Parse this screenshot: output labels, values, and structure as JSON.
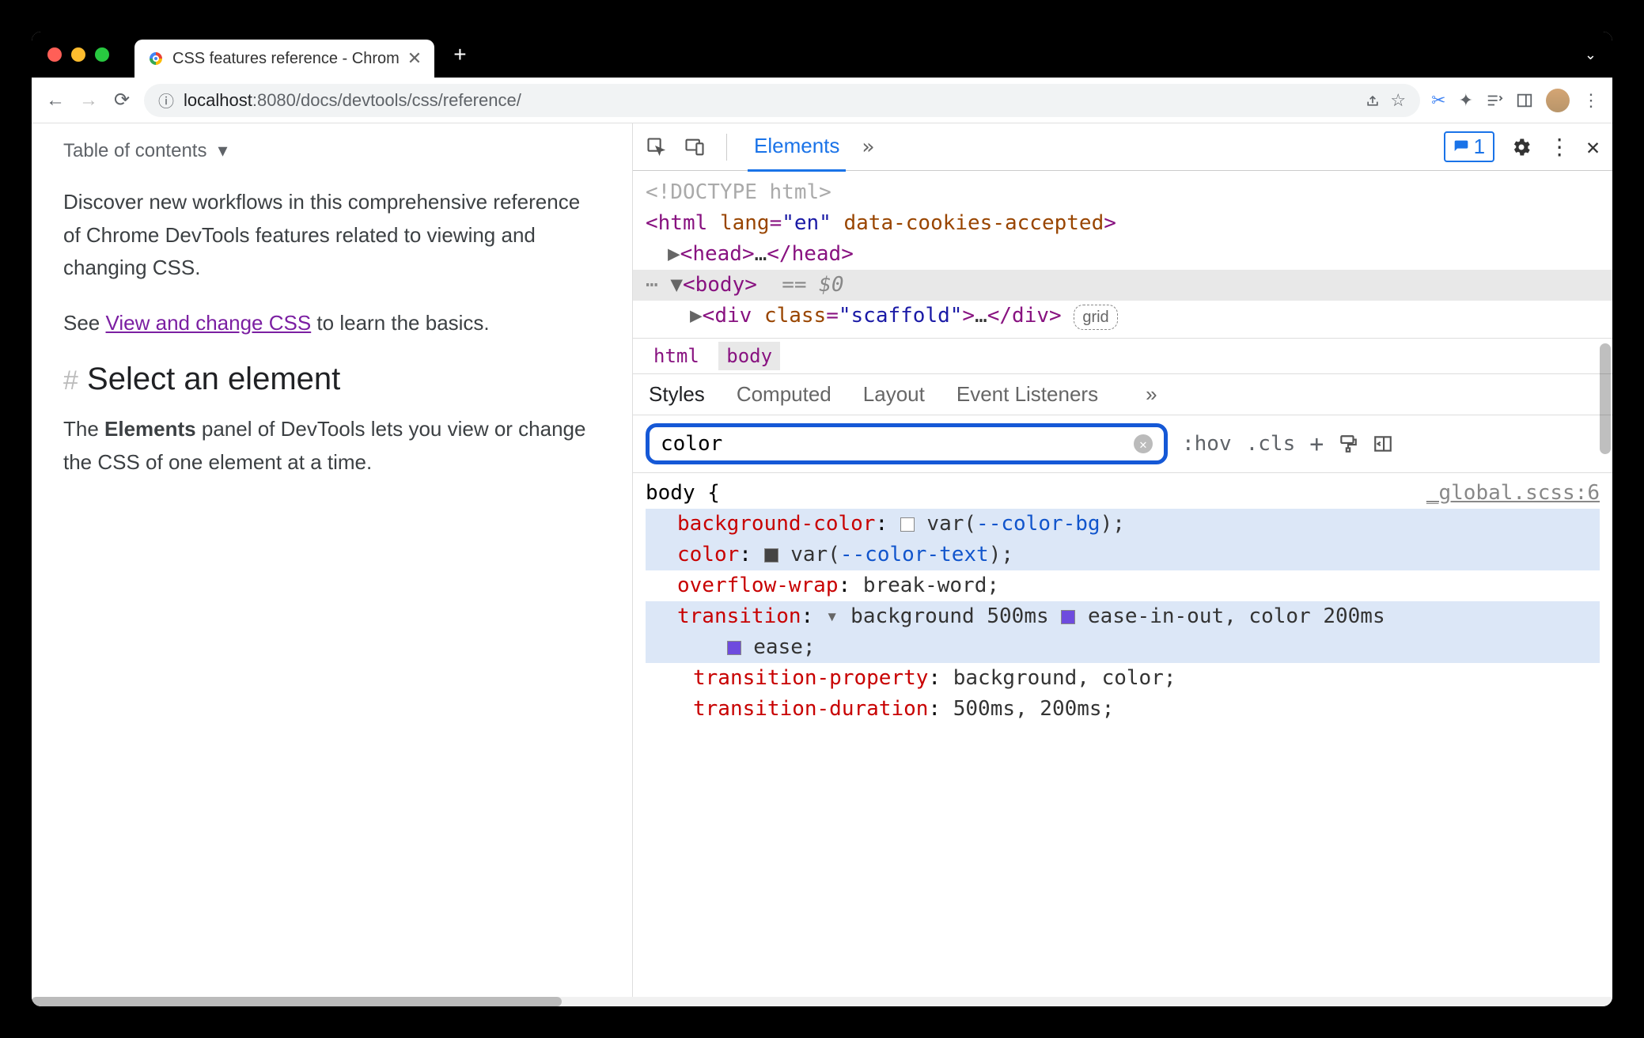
{
  "tab": {
    "title": "CSS features reference - Chrom"
  },
  "address": {
    "host": "localhost",
    "port": ":8080",
    "path": "/docs/devtools/css/reference/"
  },
  "page": {
    "toc": "Table of contents",
    "p1": "Discover new workflows in this comprehensive reference of Chrome DevTools features related to viewing and changing CSS.",
    "p2a": "See ",
    "p2link": "View and change CSS",
    "p2b": " to learn the basics.",
    "h2": "Select an element",
    "p3a": "The ",
    "p3b": "Elements",
    "p3c": " panel of DevTools lets you view or change the CSS of one element at a time."
  },
  "devtools": {
    "tabs": {
      "elements": "Elements"
    },
    "issues": "1",
    "dom": {
      "doctype": "<!DOCTYPE html>",
      "html_open": "html",
      "html_lang_attr": "lang",
      "html_lang_val": "\"en\"",
      "html_cookies_attr": "data-cookies-accepted",
      "head": "head",
      "head_ellipsis": "…",
      "body": "body",
      "body_eq": "== ",
      "body_var": "$0",
      "div": "div",
      "div_class_attr": "class",
      "div_class_val": "\"scaffold\"",
      "div_ellipsis": "…",
      "grid_badge": "grid"
    },
    "crumbs": {
      "html": "html",
      "body": "body"
    },
    "styles_tabs": {
      "styles": "Styles",
      "computed": "Computed",
      "layout": "Layout",
      "events": "Event Listeners"
    },
    "filter": {
      "value": "color",
      "hov": ":hov",
      "cls": ".cls"
    },
    "rules": {
      "selector": "body {",
      "source": "_global.scss:6",
      "p1": {
        "name": "background-color",
        "val_pre": "var(",
        "var": "--color-bg",
        "val_post": ");"
      },
      "p2": {
        "name": "color",
        "val_pre": "var(",
        "var": "--color-text",
        "val_post": ");"
      },
      "p3": {
        "name": "overflow-wrap",
        "val": "break-word;"
      },
      "p4": {
        "name": "transition",
        "val_a": "background 500ms ",
        "ease1": "ease-in-out",
        "val_b": ", color 200ms ",
        "ease2": "ease;"
      },
      "p5": {
        "name": "transition-property",
        "val": "background, color;"
      },
      "p6": {
        "name": "transition-duration",
        "val": "500ms, 200ms;"
      }
    }
  }
}
